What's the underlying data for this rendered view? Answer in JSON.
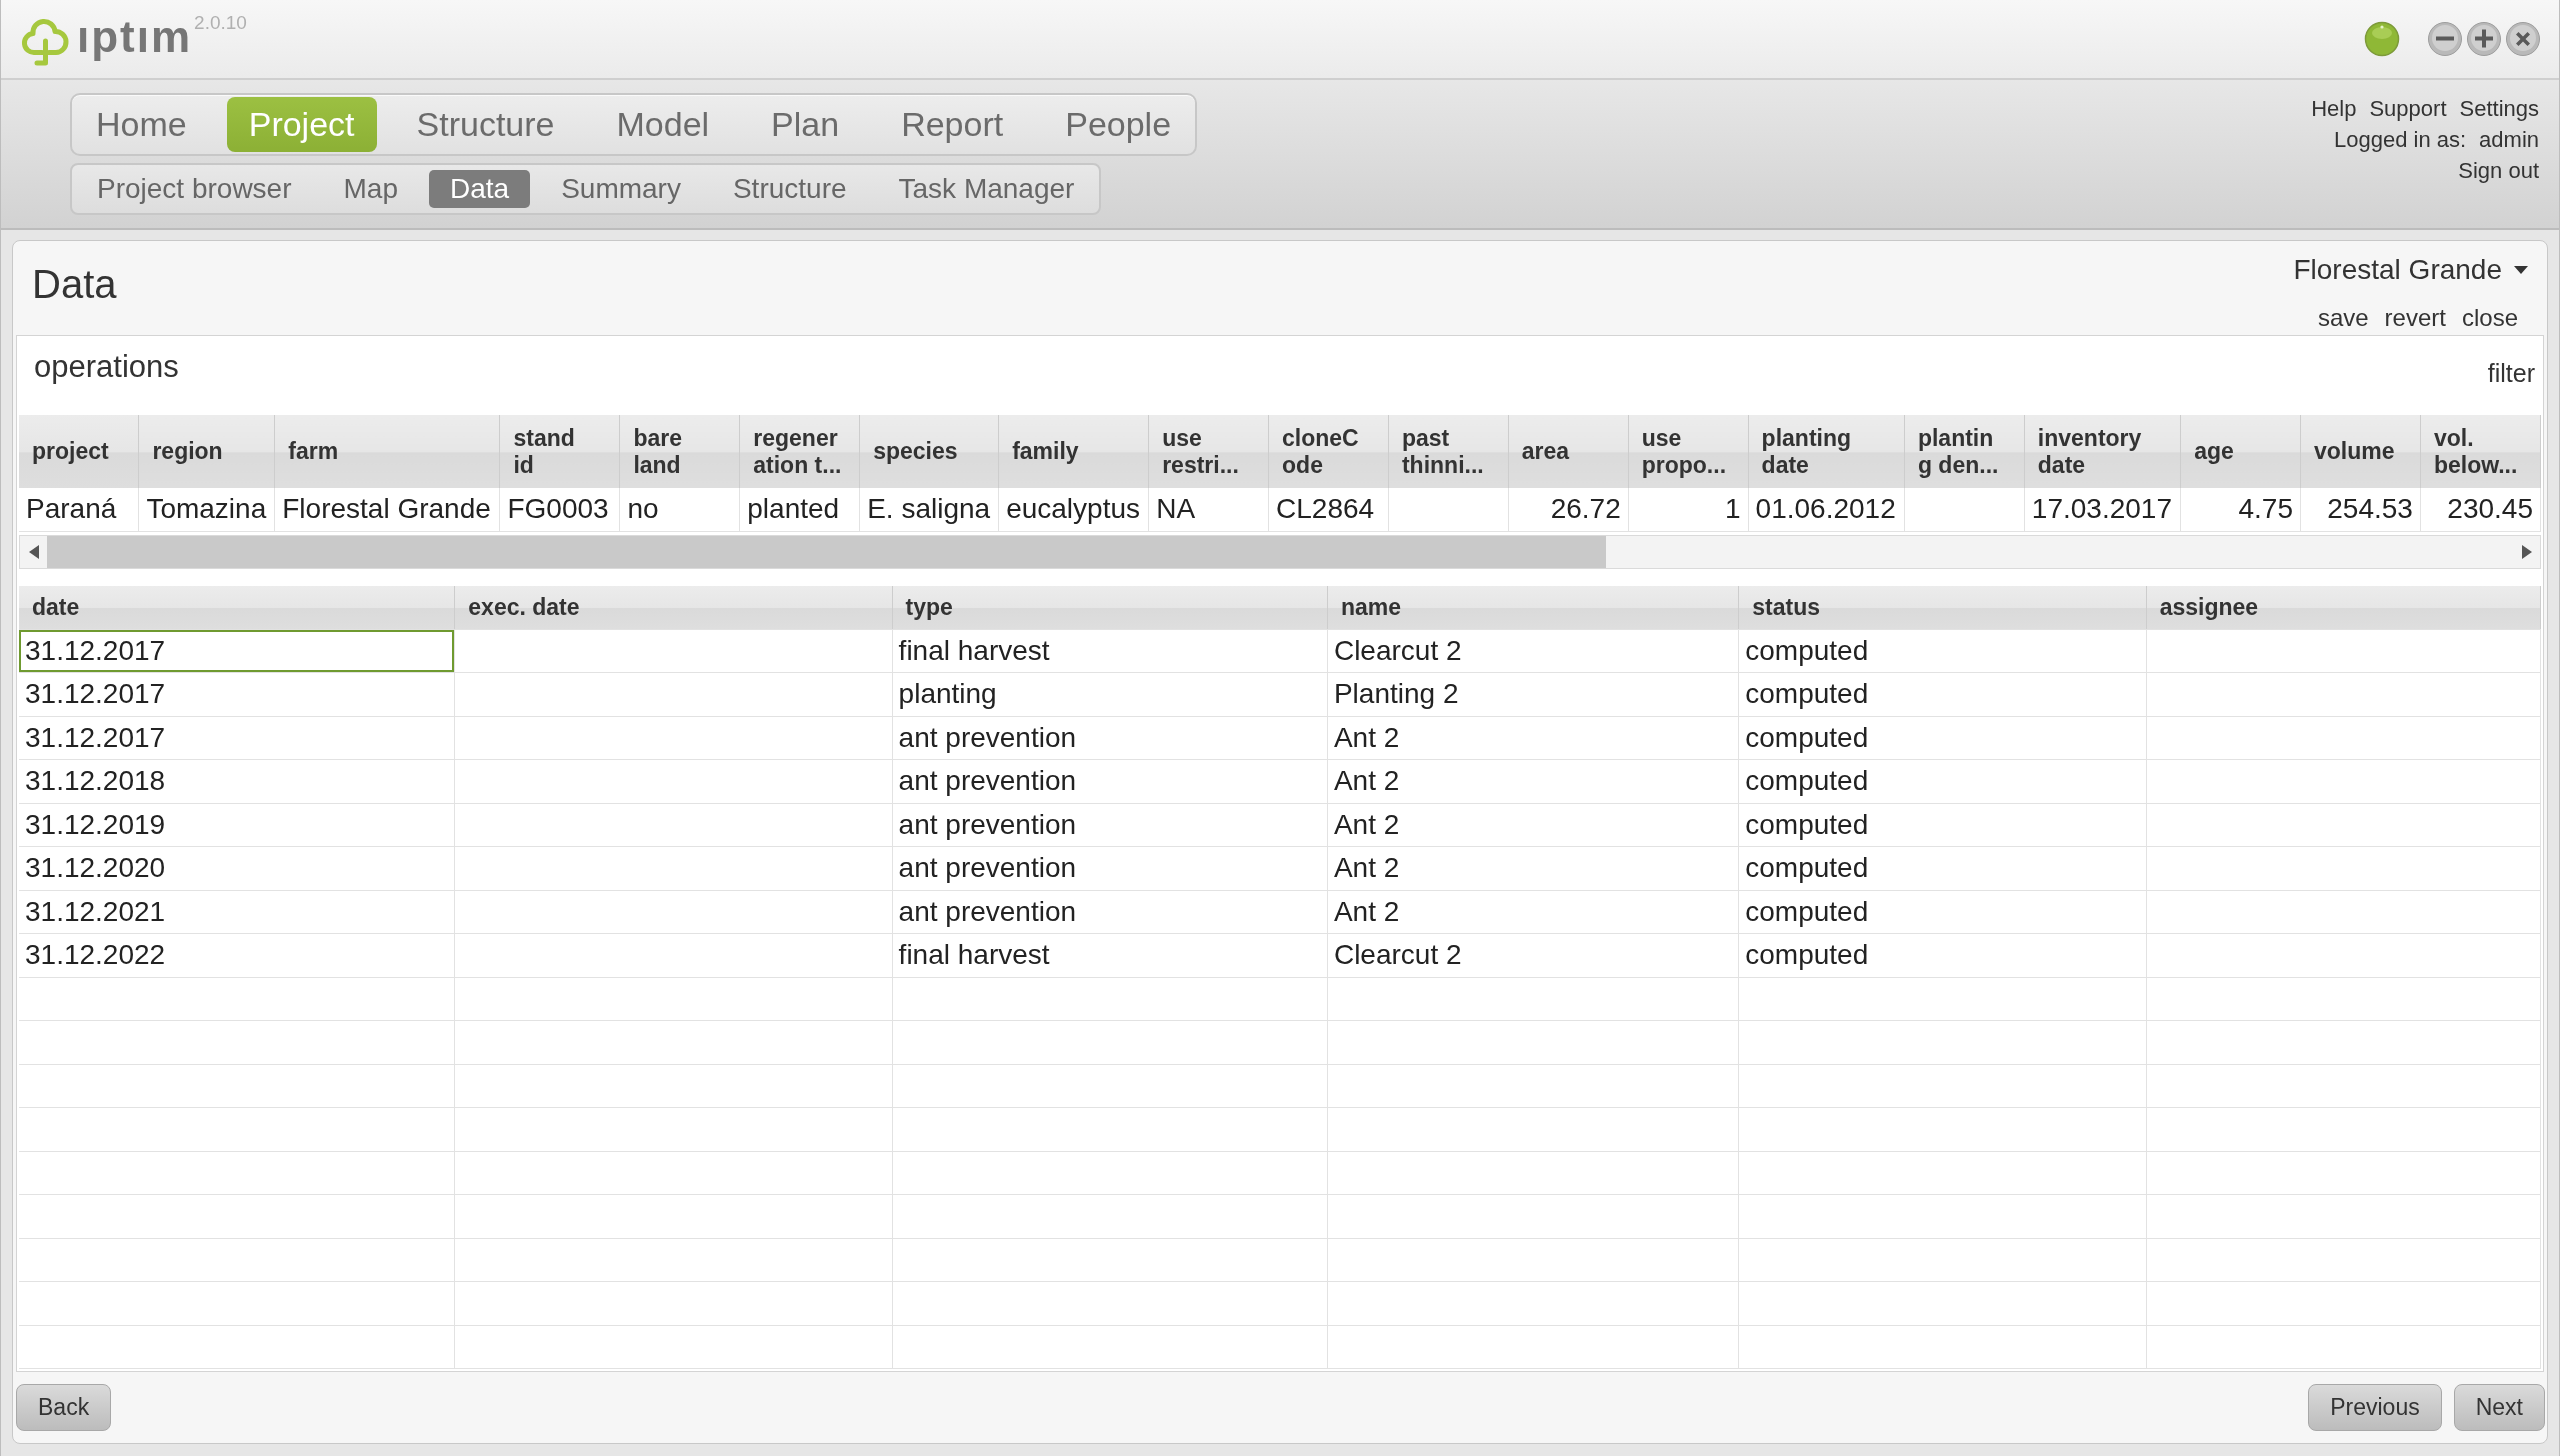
{
  "app": {
    "logo_text": "ıptım",
    "version": "2.0.10"
  },
  "main_tabs": [
    {
      "label": "Home",
      "selected": false
    },
    {
      "label": "Project",
      "selected": true
    },
    {
      "label": "Structure",
      "selected": false
    },
    {
      "label": "Model",
      "selected": false
    },
    {
      "label": "Plan",
      "selected": false
    },
    {
      "label": "Report",
      "selected": false
    },
    {
      "label": "People",
      "selected": false
    }
  ],
  "sub_tabs": [
    {
      "label": "Project browser",
      "selected": false
    },
    {
      "label": "Map",
      "selected": false
    },
    {
      "label": "Data",
      "selected": true
    },
    {
      "label": "Summary",
      "selected": false
    },
    {
      "label": "Structure",
      "selected": false
    },
    {
      "label": "Task Manager",
      "selected": false
    }
  ],
  "user_menu": {
    "links": [
      "Help",
      "Support",
      "Settings"
    ],
    "logged_in_label": "Logged in as:",
    "user": "admin",
    "sign_out": "Sign out"
  },
  "page": {
    "title": "Data",
    "project_selector": "Florestal Grande",
    "actions": [
      "save",
      "revert",
      "close"
    ]
  },
  "operations": {
    "title": "operations",
    "filter": "filter",
    "stand_table": {
      "columns": [
        {
          "header": [
            "project"
          ],
          "kind": "text",
          "cell": "Paraná"
        },
        {
          "header": [
            "region"
          ],
          "kind": "text",
          "cell": "Tomazina"
        },
        {
          "header": [
            "farm"
          ],
          "kind": "text",
          "cell": "Florestal Grande"
        },
        {
          "header": [
            "stand",
            "id"
          ],
          "kind": "text",
          "cell": "FG0003"
        },
        {
          "header": [
            "bare",
            "land"
          ],
          "kind": "text",
          "cell": "no"
        },
        {
          "header": [
            "regener",
            "ation t..."
          ],
          "kind": "text",
          "cell": "planted"
        },
        {
          "header": [
            "species"
          ],
          "kind": "text",
          "cell": "E. saligna"
        },
        {
          "header": [
            "family"
          ],
          "kind": "text",
          "cell": "eucalyptus"
        },
        {
          "header": [
            "use",
            "restri..."
          ],
          "kind": "text",
          "cell": "NA"
        },
        {
          "header": [
            "cloneC",
            "ode"
          ],
          "kind": "text",
          "cell": "CL2864"
        },
        {
          "header": [
            "past",
            "thinni..."
          ],
          "kind": "text"
        },
        {
          "header": [
            "area"
          ],
          "kind": "number",
          "cell": "26.72"
        },
        {
          "header": [
            "use",
            "propo..."
          ],
          "kind": "number",
          "cell": "1"
        },
        {
          "header": [
            "planting",
            "date"
          ],
          "kind": "text",
          "cell": "01.06.2012"
        },
        {
          "header": [
            "plantin",
            "g den..."
          ],
          "kind": "text"
        },
        {
          "header": [
            "inventory",
            "date"
          ],
          "kind": "text",
          "cell": "17.03.2017"
        },
        {
          "header": [
            "age"
          ],
          "kind": "number",
          "cell": "4.75"
        },
        {
          "header": [
            "volume"
          ],
          "kind": "number",
          "cell": "254.53"
        },
        {
          "header": [
            "vol.",
            "below..."
          ],
          "kind": "number",
          "cell": "230.45"
        }
      ]
    },
    "columns": [
      "date",
      "exec. date",
      "type",
      "name",
      "status",
      "assignee"
    ],
    "rows": [
      {
        "date": "31.12.2017",
        "type": "final harvest",
        "name": "Clearcut 2",
        "status": "computed",
        "selected": true
      },
      {
        "date": "31.12.2017",
        "type": "planting",
        "name": "Planting 2",
        "status": "computed",
        "selected": false
      },
      {
        "date": "31.12.2017",
        "type": "ant prevention",
        "name": "Ant 2",
        "status": "computed",
        "selected": false
      },
      {
        "date": "31.12.2018",
        "type": "ant prevention",
        "name": "Ant 2",
        "status": "computed",
        "selected": false
      },
      {
        "date": "31.12.2019",
        "type": "ant prevention",
        "name": "Ant 2",
        "status": "computed",
        "selected": false
      },
      {
        "date": "31.12.2020",
        "type": "ant prevention",
        "name": "Ant 2",
        "status": "computed",
        "selected": false
      },
      {
        "date": "31.12.2021",
        "type": "ant prevention",
        "name": "Ant 2",
        "status": "computed",
        "selected": false
      },
      {
        "date": "31.12.2022",
        "type": "final harvest",
        "name": "Clearcut 2",
        "status": "computed",
        "selected": false
      }
    ]
  },
  "footer": {
    "back": "Back",
    "previous": "Previous",
    "next": "Next"
  }
}
